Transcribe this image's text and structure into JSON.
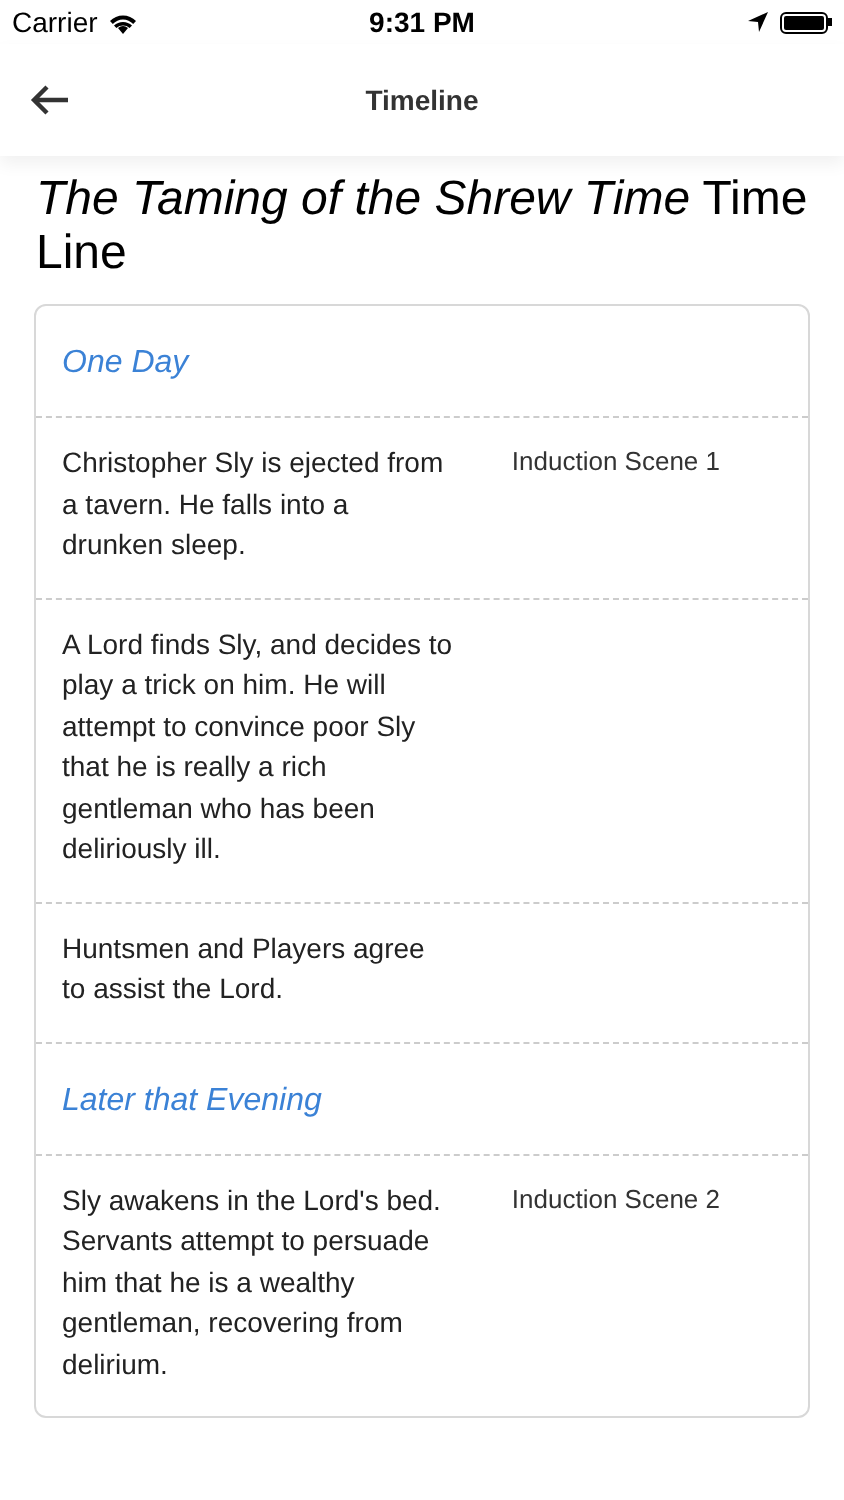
{
  "status_bar": {
    "carrier": "Carrier",
    "time": "9:31 PM"
  },
  "nav": {
    "title": "Timeline"
  },
  "heading": {
    "italic_part": "The Taming of the Shrew Time",
    "plain_part": "Time Line"
  },
  "rows": [
    {
      "kind": "section",
      "title": "One Day"
    },
    {
      "kind": "event",
      "description": "Christopher Sly is ejected from a tavern. He falls into a drunken sleep.",
      "scene": "Induction Scene 1"
    },
    {
      "kind": "event",
      "description": "A Lord finds Sly, and decides to play a trick on him. He will attempt to convince poor Sly that he is really a rich gentleman who has been deliriously ill."
    },
    {
      "kind": "event",
      "description": "Huntsmen and Players agree to assist the Lord."
    },
    {
      "kind": "section",
      "title": "Later that Evening"
    },
    {
      "kind": "event",
      "description": "Sly awakens in the Lord's bed. Servants attempt to persuade him that he is a wealthy gentleman, recovering from delirium.",
      "scene": "Induction Scene 2"
    }
  ]
}
